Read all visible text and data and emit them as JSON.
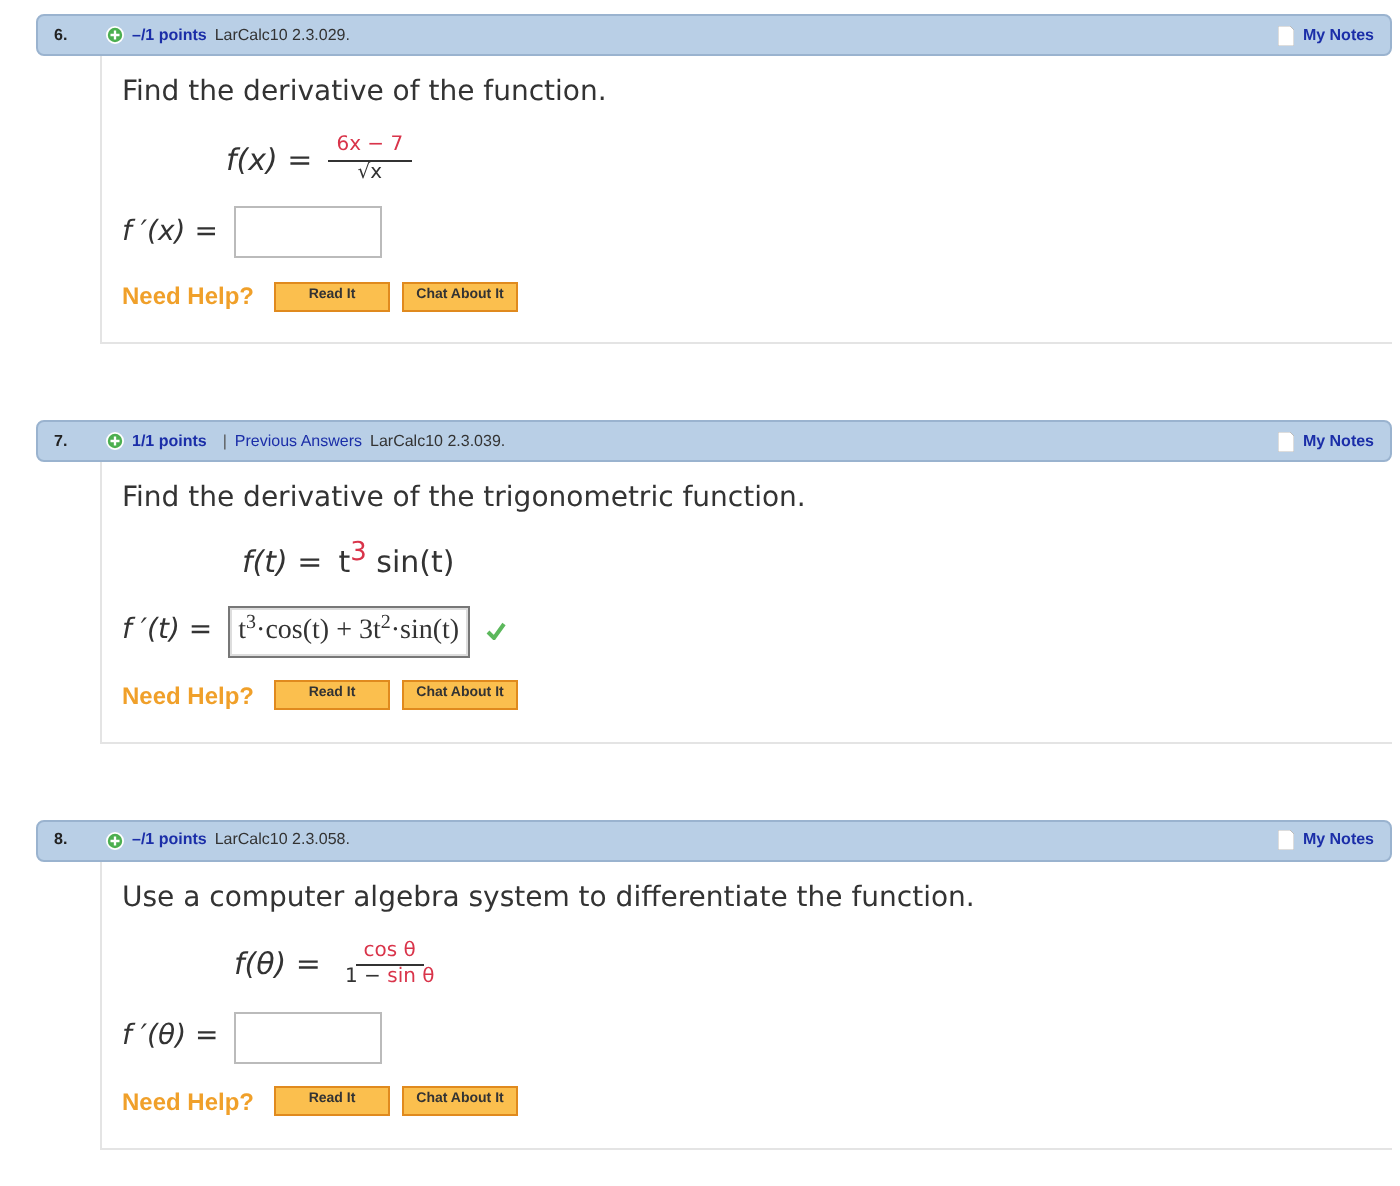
{
  "questions": [
    {
      "number": "6.",
      "points": "–/1 points",
      "source": "LarCalc10 2.3.029.",
      "notes": "My Notes",
      "prompt": "Find the derivative of the function.",
      "formula": {
        "kind": "fraction",
        "lhs": "f(x) =",
        "numerator": [
          {
            "text": "6x − 7",
            "highlight": true
          }
        ],
        "denominator": [
          {
            "text": "√x",
            "highlight": false
          }
        ]
      },
      "answer_label": "f ′(x) =",
      "answer": {
        "correct": false
      },
      "help": "Need Help?",
      "buttons": [
        "Read It",
        "Chat About It"
      ]
    },
    {
      "number": "7.",
      "points": "1/1 points",
      "separator": "|",
      "previous_answers": "Previous Answers",
      "source": "LarCalc10 2.3.039.",
      "notes": "My Notes",
      "prompt": "Find the derivative of the trigonometric function.",
      "formula": {
        "kind": "inline",
        "lhs": "f(t) =",
        "expression": "t$^{3}$ sin(t)"
      },
      "answer_label": "f ′(t) =",
      "answer": {
        "value": "t$^{3}$·cos(t) + 3t$^{2}$·sin(t)",
        "correct": true
      },
      "help": "Need Help?",
      "buttons": [
        "Read It",
        "Chat About It"
      ]
    },
    {
      "number": "8.",
      "points": "–/1 points",
      "source": "LarCalc10 2.3.058.",
      "notes": "My Notes",
      "prompt": "Use a computer algebra system to differentiate the function.",
      "formula": {
        "kind": "fraction",
        "lhs": "f(θ) =",
        "numerator": [
          {
            "text": "cos θ",
            "highlight": true
          }
        ],
        "denominator": [
          {
            "text": "1 − ",
            "highlight": false
          },
          {
            "text": "sin θ",
            "highlight": true
          }
        ]
      },
      "answer_label": "f ′(θ) =",
      "answer": {
        "correct": false
      },
      "help": "Need Help?",
      "buttons": [
        "Read It",
        "Chat About It"
      ]
    }
  ]
}
